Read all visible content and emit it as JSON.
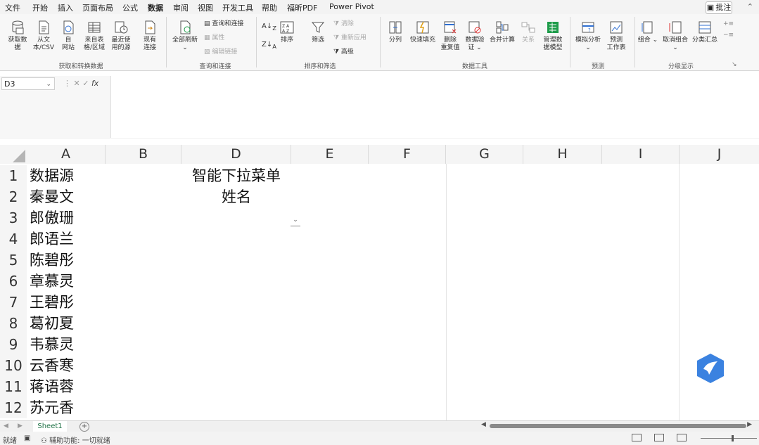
{
  "menu": {
    "tabs": [
      "文件",
      "开始",
      "插入",
      "页面布局",
      "公式",
      "数据",
      "审阅",
      "视图",
      "开发工具",
      "帮助",
      "福昕PDF",
      "Power Pivot"
    ],
    "active_tab": "数据",
    "comment_label": "批注"
  },
  "ribbon": {
    "groups": {
      "get_transform": "获取和转换数据",
      "queries": "查询和连接",
      "sort_filter": "排序和筛选",
      "data_tools": "数据工具",
      "forecast": "预测",
      "outline": "分级显示"
    },
    "buttons": {
      "get_data": "获取数\n据",
      "from_text": "从文\n本/CSV",
      "from_web": "自\n网站",
      "from_table": "来自表\n格/区域",
      "recent_sources": "最近使\n用的源",
      "existing_conn": "现有\n连接",
      "refresh_all": "全部刷新",
      "queries_conn": "查询和连接",
      "properties": "属性",
      "edit_links": "编辑链接",
      "sort": "排序",
      "filter": "筛选",
      "clear": "清除",
      "reapply": "重新应用",
      "advanced": "高级",
      "text_to_columns": "分列",
      "flash_fill": "快速填充",
      "remove_dup": "删除\n重复值",
      "validation": "数据验\n证",
      "consolidate": "合并计算",
      "relationships": "关系",
      "data_model": "管理数\n据模型",
      "what_if": "模拟分析",
      "forecast_sheet": "预测\n工作表",
      "group": "组合",
      "ungroup": "取消组合",
      "subtotal": "分类汇总"
    }
  },
  "formula_bar": {
    "name_box": "D3",
    "fx": "fx",
    "value": ""
  },
  "columns": [
    "A",
    "B",
    "D",
    "E",
    "F",
    "G",
    "H",
    "I",
    "J"
  ],
  "rows": [
    "1",
    "2",
    "3",
    "4",
    "5",
    "6",
    "7",
    "8",
    "9",
    "10",
    "11",
    "12"
  ],
  "cells": {
    "col_a": [
      "数据源",
      "秦曼文",
      "郎傲珊",
      "郎语兰",
      "陈碧彤",
      "章慕灵",
      "王碧彤",
      "葛初夏",
      "韦慕灵",
      "云香寒",
      "蒋语蓉",
      "苏元香"
    ],
    "d1": "智能下拉菜单",
    "d2": "姓名"
  },
  "sheets": {
    "active": "Sheet1"
  },
  "status": {
    "ready": "就绪",
    "accessibility": "辅助功能: 一切就绪"
  },
  "colors": {
    "accent": "#1e7145",
    "logo": "#3b82e0"
  }
}
